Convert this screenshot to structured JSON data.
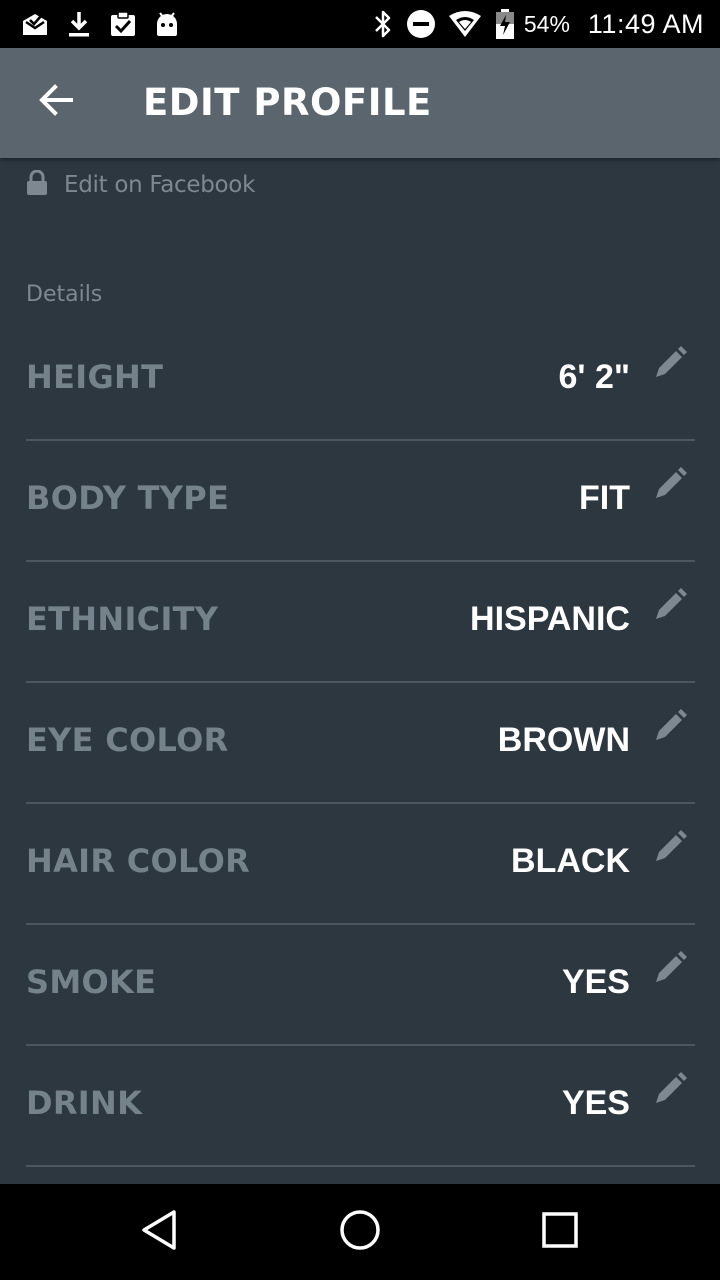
{
  "status_bar": {
    "left_icons": [
      "mail-check-icon",
      "download-icon",
      "clipboard-check-icon",
      "android-icon"
    ],
    "right_icons": [
      "bluetooth-icon",
      "do-not-disturb-icon",
      "wifi-icon",
      "battery-charging-icon"
    ],
    "battery_percent": "54%",
    "time": "11:49 AM"
  },
  "app_bar": {
    "back_icon": "arrow-left-icon",
    "title": "EDIT PROFILE",
    "background": "#5a656d"
  },
  "facebook": {
    "icon": "lock-icon",
    "label": "Edit on Facebook"
  },
  "details": {
    "heading": "Details",
    "rows": [
      {
        "label": "HEIGHT",
        "value": "6' 2\""
      },
      {
        "label": "BODY TYPE",
        "value": "FIT"
      },
      {
        "label": "ETHNICITY",
        "value": "HISPANIC"
      },
      {
        "label": "EYE COLOR",
        "value": "BROWN"
      },
      {
        "label": "HAIR COLOR",
        "value": "BLACK"
      },
      {
        "label": "SMOKE",
        "value": "YES"
      },
      {
        "label": "DRINK",
        "value": "YES"
      }
    ],
    "edit_icon": "pencil-icon"
  },
  "nav_bar": {
    "buttons": [
      "back-triangle-icon",
      "home-circle-icon",
      "recents-square-icon"
    ]
  },
  "colors": {
    "background": "#2c3740",
    "label_text": "#76828a",
    "value_text": "#ffffff",
    "divider": "#4c565e"
  }
}
